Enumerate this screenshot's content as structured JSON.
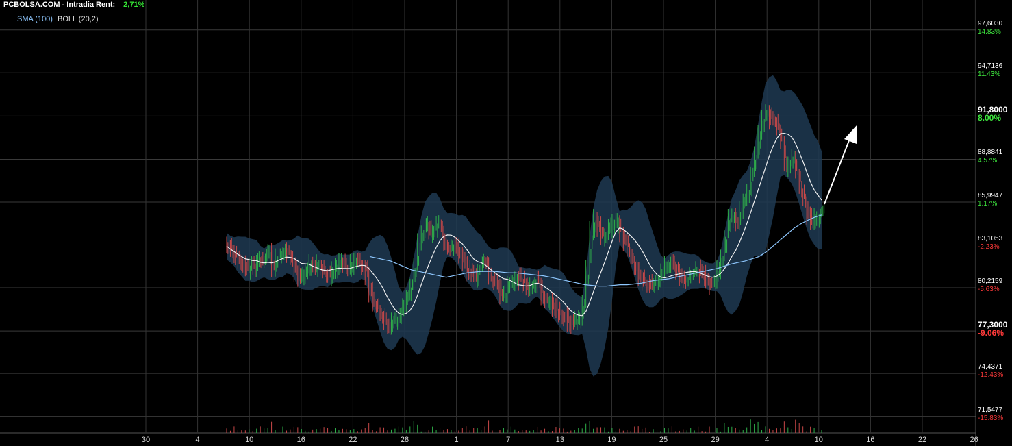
{
  "header": {
    "title": "PCBOLSA.COM - Intradia  Rent:",
    "rent": "2,71%"
  },
  "legend": {
    "sma": "SMA (100)",
    "boll": "BOLL (20,2)"
  },
  "chart_data": {
    "type": "candlestick",
    "grid": true,
    "ylim": [
      70.1,
      99.3
    ],
    "y_ticks": [
      {
        "price": "97,6030",
        "pct": "14.83%",
        "sign": "pos",
        "emph": false
      },
      {
        "price": "94,7136",
        "pct": "11.43%",
        "sign": "pos",
        "emph": false
      },
      {
        "price": "91,8000",
        "pct": "8.00%",
        "sign": "pos",
        "emph": true
      },
      {
        "price": "88,8841",
        "pct": "4.57%",
        "sign": "pos",
        "emph": false
      },
      {
        "price": "85,9947",
        "pct": "1.17%",
        "sign": "pos",
        "emph": false
      },
      {
        "price": "83,1053",
        "pct": "-2.23%",
        "sign": "neg",
        "emph": false
      },
      {
        "price": "80,2159",
        "pct": "-5.63%",
        "sign": "neg",
        "emph": false
      },
      {
        "price": "77,3000",
        "pct": "-9.06%",
        "sign": "neg",
        "emph": true
      },
      {
        "price": "74,4371",
        "pct": "-12.43%",
        "sign": "neg",
        "emph": false
      },
      {
        "price": "71,5477",
        "pct": "-15.83%",
        "sign": "neg",
        "emph": false
      }
    ],
    "x_ticks": [
      "30",
      "4",
      "10",
      "16",
      "22",
      "28",
      "1",
      "7",
      "13",
      "19",
      "25",
      "29",
      "4",
      "10",
      "16",
      "22",
      "26"
    ],
    "close": [
      82.7,
      82.3,
      82.0,
      81.6,
      81.4,
      81.1,
      81.5,
      81.2,
      81.8,
      81.6,
      81.9,
      82.4,
      81.3,
      81.9,
      82.3,
      82.4,
      82.1,
      81.6,
      81.0,
      80.4,
      80.8,
      81.1,
      81.6,
      81.2,
      81.5,
      81.1,
      81.0,
      80.7,
      81.0,
      81.3,
      81.6,
      81.4,
      81.2,
      81.5,
      81.9,
      81.6,
      81.2,
      80.8,
      79.6,
      78.8,
      78.5,
      77.9,
      77.5,
      77.3,
      77.6,
      77.9,
      78.4,
      78.9,
      79.5,
      80.3,
      81.6,
      82.9,
      83.8,
      84.1,
      83.5,
      83.9,
      84.0,
      83.5,
      82.9,
      82.5,
      82.8,
      82.5,
      82.0,
      81.6,
      81.0,
      80.8,
      80.5,
      81.3,
      81.8,
      81.6,
      80.5,
      80.3,
      79.8,
      79.3,
      79.5,
      80.1,
      80.3,
      80.6,
      80.4,
      80.2,
      79.9,
      80.1,
      80.3,
      80.0,
      79.3,
      78.8,
      79.0,
      78.6,
      78.3,
      78.1,
      77.9,
      77.6,
      77.5,
      77.6,
      77.8,
      78.7,
      81.1,
      83.8,
      84.5,
      84.0,
      83.4,
      83.6,
      83.9,
      84.2,
      84.4,
      83.6,
      83.0,
      82.5,
      81.8,
      81.1,
      80.6,
      80.4,
      80.2,
      80.0,
      80.1,
      80.4,
      80.9,
      81.4,
      81.6,
      81.4,
      81.0,
      80.7,
      80.4,
      80.6,
      80.8,
      81.0,
      80.9,
      80.7,
      80.5,
      80.1,
      80.4,
      81.2,
      82.1,
      83.6,
      84.5,
      84.9,
      84.3,
      85.3,
      85.6,
      86.4,
      87.8,
      88.9,
      90.5,
      91.4,
      91.8,
      91.3,
      91.1,
      90.4,
      89.4,
      88.0,
      88.3,
      88.8,
      87.7,
      86.4,
      85.6,
      84.8,
      84.3,
      84.6,
      84.9,
      85.1
    ],
    "sma_100": [
      82.0,
      81.9,
      81.8,
      81.7,
      81.5,
      81.3,
      81.1,
      81.0,
      80.9,
      80.8,
      80.7,
      80.6,
      80.7,
      80.8,
      80.9,
      80.95,
      81.0,
      81.0,
      81.0,
      80.95,
      80.9,
      80.9,
      80.85,
      80.8,
      80.75,
      80.7,
      80.6,
      80.5,
      80.4,
      80.3,
      80.2,
      80.1,
      80.05,
      80.0,
      80.0,
      80.05,
      80.1,
      80.1,
      80.15,
      80.2,
      80.3,
      80.4,
      80.45,
      80.5,
      80.6,
      80.7,
      80.8,
      80.9,
      81.0,
      81.1,
      81.2,
      81.35,
      81.5,
      81.6,
      81.7,
      81.85,
      82.0,
      82.3,
      82.7,
      83.1,
      83.5,
      83.9,
      84.2,
      84.45,
      84.65,
      84.8
    ]
  }
}
